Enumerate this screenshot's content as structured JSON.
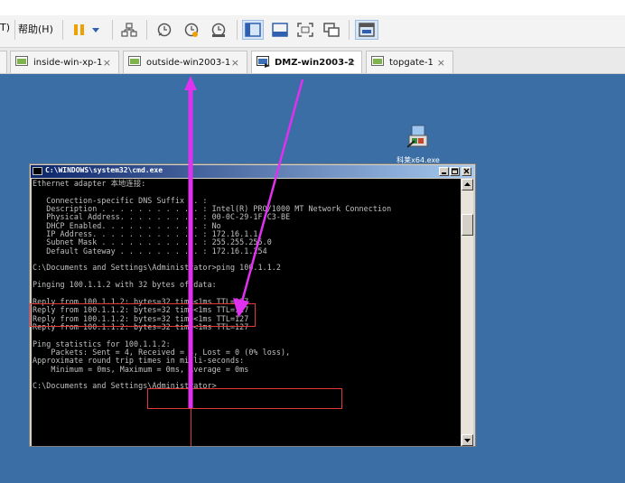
{
  "menu": {
    "prev_item": "T)",
    "help": "帮助(H)"
  },
  "tabs": [
    {
      "label": "inside-win-xp-1",
      "active": false
    },
    {
      "label": "outside-win2003-1",
      "active": false
    },
    {
      "label": "DMZ-win2003-2",
      "active": true
    },
    {
      "label": "topgate-1",
      "active": false
    }
  ],
  "tab_close_glyph": "×",
  "desktop_icon": {
    "label": "科莱x64.exe",
    "icon": "installer-icon"
  },
  "cmd": {
    "title": "C:\\WINDOWS\\system32\\cmd.exe",
    "lines": [
      "Ethernet adapter 本地连接:",
      "",
      "   Connection-specific DNS Suffix  . :",
      "   Description . . . . . . . . . . . : Intel(R) PRO/1000 MT Network Connection",
      "   Physical Address. . . . . . . . . : 00-0C-29-1F-C3-BE",
      "   DHCP Enabled. . . . . . . . . . . : No",
      "   IP Address. . . . . . . . . . . . : 172.16.1.1",
      "   Subnet Mask . . . . . . . . . . . : 255.255.255.0",
      "   Default Gateway . . . . . . . . . : 172.16.1.254",
      "",
      "C:\\Documents and Settings\\Administrator>ping 100.1.1.2",
      "",
      "Pinging 100.1.1.2 with 32 bytes of data:",
      "",
      "Reply from 100.1.1.2: bytes=32 time<1ms TTL=127",
      "Reply from 100.1.1.2: bytes=32 time<1ms TTL=127",
      "Reply from 100.1.1.2: bytes=32 time<1ms TTL=127",
      "Reply from 100.1.1.2: bytes=32 time<1ms TTL=127",
      "",
      "Ping statistics for 100.1.1.2:",
      "    Packets: Sent = 4, Received = 4, Lost = 0 (0% loss),",
      "Approximate round trip times in milli-seconds:",
      "    Minimum = 0ms, Maximum = 0ms, Average = 0ms",
      "",
      "C:\\Documents and Settings\\Administrator>"
    ]
  },
  "colors": {
    "desktop": "#3a6ea5",
    "annotation_arrow": "#e030f0",
    "highlight_box": "#e23a3a",
    "pause_icon": "#f0a000"
  }
}
